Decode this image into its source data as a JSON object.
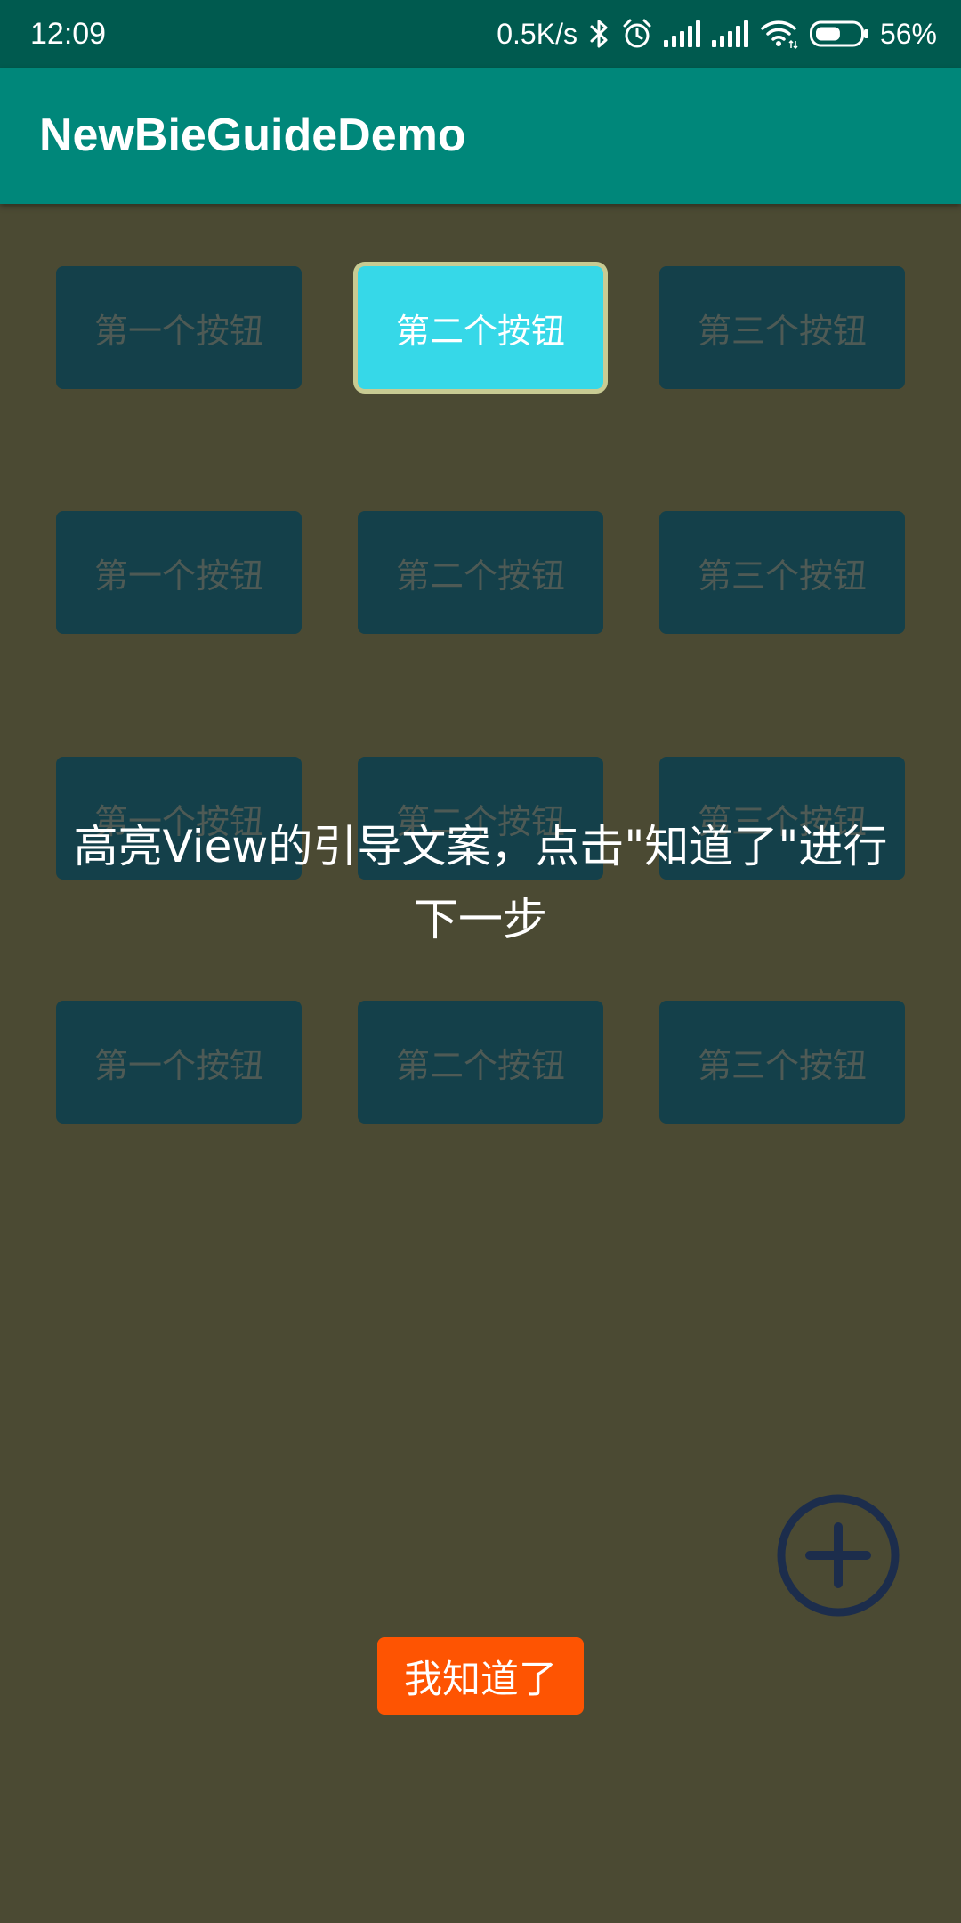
{
  "status_bar": {
    "time": "12:09",
    "net_speed": "0.5K/s",
    "battery_text": "56%",
    "icons": {
      "bluetooth": "bluetooth-icon",
      "alarm": "alarm-icon",
      "signal": "signal-icon",
      "wifi": "wifi-icon",
      "battery": "battery-icon"
    }
  },
  "app_bar": {
    "title": "NewBieGuideDemo"
  },
  "grid": {
    "rows": [
      [
        {
          "label": "第一个按钮",
          "highlighted": false
        },
        {
          "label": "第二个按钮",
          "highlighted": true
        },
        {
          "label": "第三个按钮",
          "highlighted": false
        }
      ],
      [
        {
          "label": "第一个按钮",
          "highlighted": false
        },
        {
          "label": "第二个按钮",
          "highlighted": false
        },
        {
          "label": "第三个按钮",
          "highlighted": false
        }
      ],
      [
        {
          "label": "第一个按钮",
          "highlighted": false
        },
        {
          "label": "第二个按钮",
          "highlighted": false
        },
        {
          "label": "第三个按钮",
          "highlighted": false
        }
      ],
      [
        {
          "label": "第一个按钮",
          "highlighted": false
        },
        {
          "label": "第二个按钮",
          "highlighted": false
        },
        {
          "label": "第三个按钮",
          "highlighted": false
        }
      ]
    ]
  },
  "guide": {
    "text": "高亮View的引导文案，点击\"知道了\"进行下一步",
    "confirm_label": "我知道了"
  },
  "fab": {
    "icon": "add-icon"
  },
  "colors": {
    "status_bar": "#005a4f",
    "app_bar": "#00877a",
    "overlay": "#4b4a33",
    "button_dimmed": "#14404a",
    "button_highlighted": "#36d8e8",
    "highlight_border": "#c8cb93",
    "confirm_button": "#fe5402",
    "fab": "#1c2d4c"
  }
}
